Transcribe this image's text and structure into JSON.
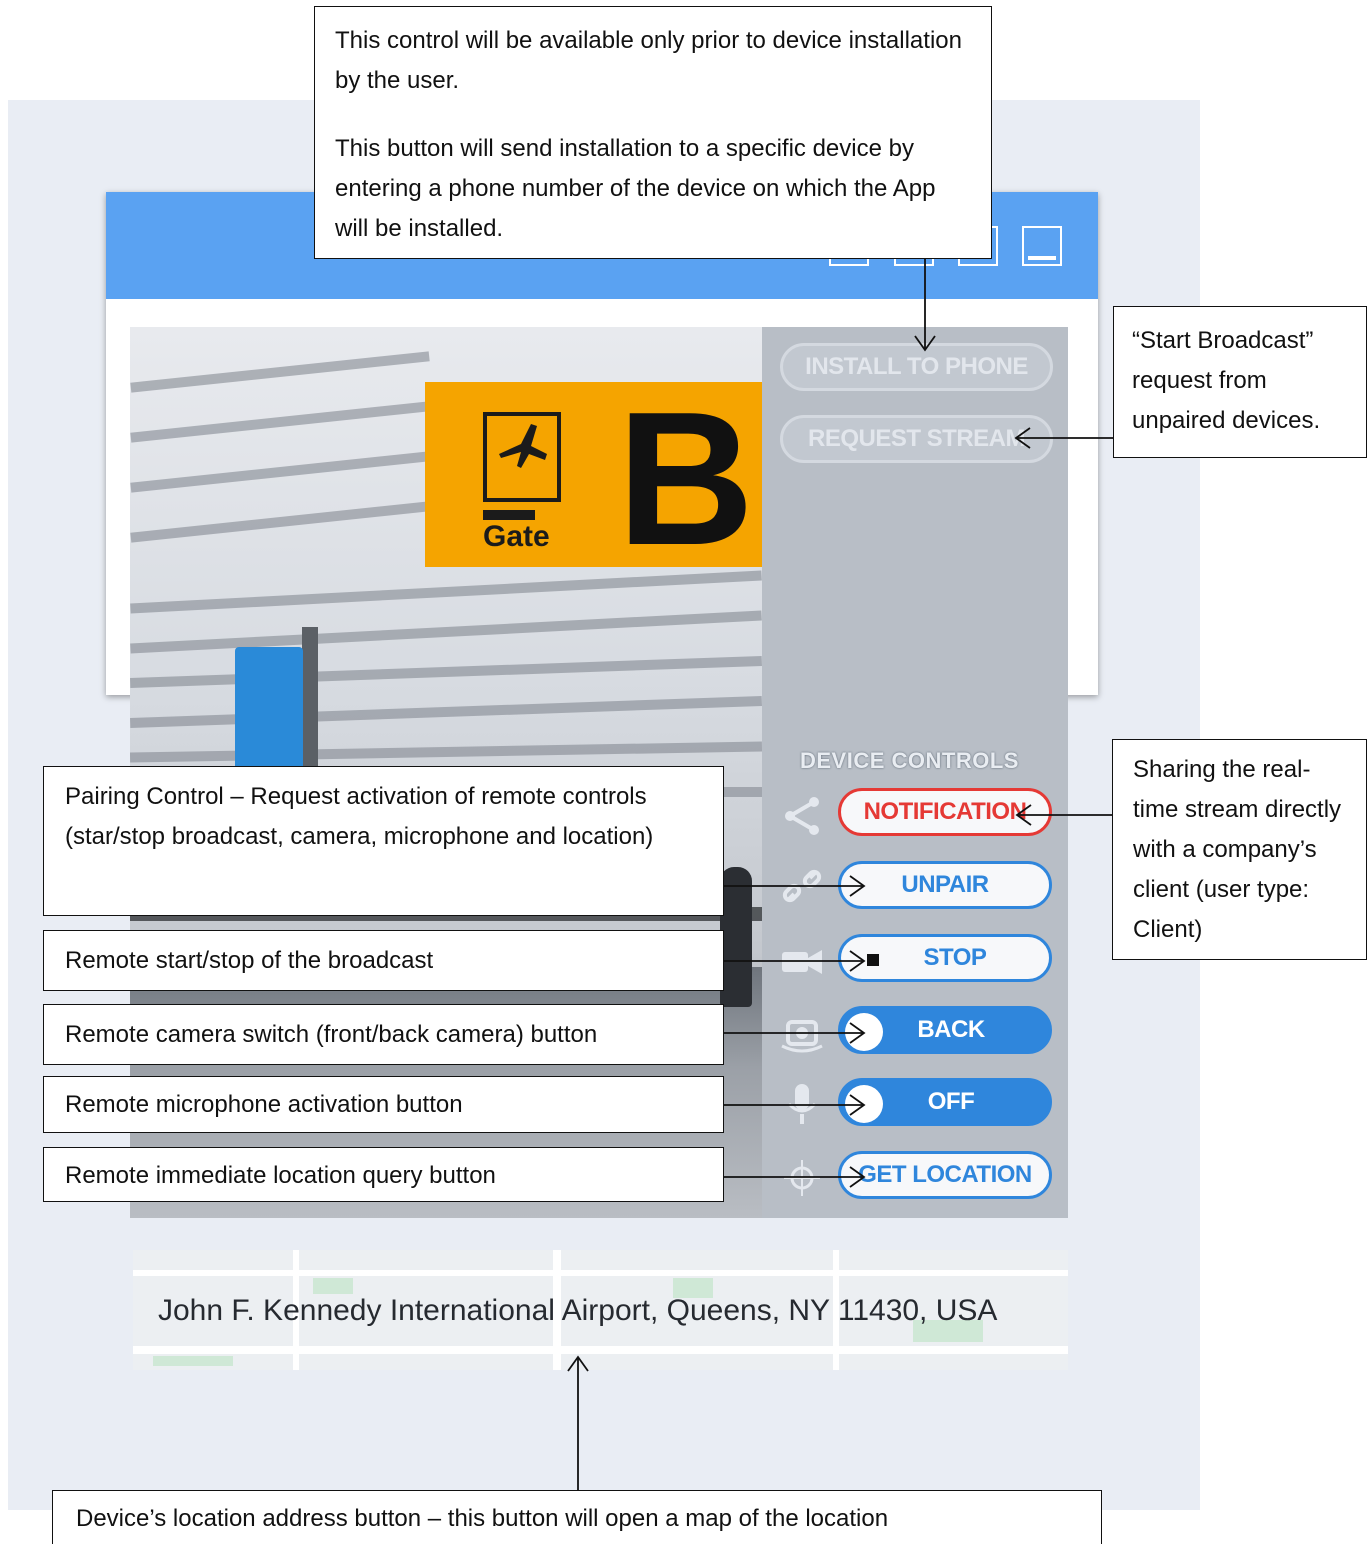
{
  "window": {
    "title_bar_color": "#5aa2f2",
    "controls": [
      "minimize-icon",
      "restore-icon",
      "square-icon",
      "maximize-icon"
    ]
  },
  "video": {
    "gate_word": "Gate",
    "gate_letter": "B"
  },
  "side_panel": {
    "install_to_phone": "INSTALL TO PHONE",
    "request_stream": "REQUEST STREAM",
    "device_controls_title": "DEVICE CONTROLS",
    "notification": "NOTIFICATION",
    "unpair": "UNPAIR",
    "stop": "STOP",
    "back": "BACK",
    "off": "OFF",
    "get_location": "GET LOCATION"
  },
  "location": {
    "address": "John F. Kennedy International Airport, Queens, NY 11430, USA"
  },
  "callouts": {
    "install": {
      "line1": "This control will be available only prior to device installation by the user.",
      "line2": "This button will send installation to a specific device by entering a phone number of the device on which the App will be installed."
    },
    "request_stream": "“Start Broadcast” request from unpaired devices.",
    "notification": "Sharing the real-time stream directly with a company’s client (user type: Client)",
    "pairing": "Pairing Control – Request activation of remote controls (star/stop broadcast, camera, microphone and location)",
    "broadcast": "Remote start/stop of the broadcast",
    "camera": "Remote camera switch (front/back camera) button",
    "microphone": "Remote microphone activation button",
    "location_query": "Remote immediate location query button",
    "address_button": "Device’s location address button – this button will open a map of the location"
  },
  "colors": {
    "accent_blue": "#2f86dc",
    "alert_red": "#e53935",
    "panel_gray": "#b8bec6",
    "sign_yellow": "#f5a400"
  }
}
